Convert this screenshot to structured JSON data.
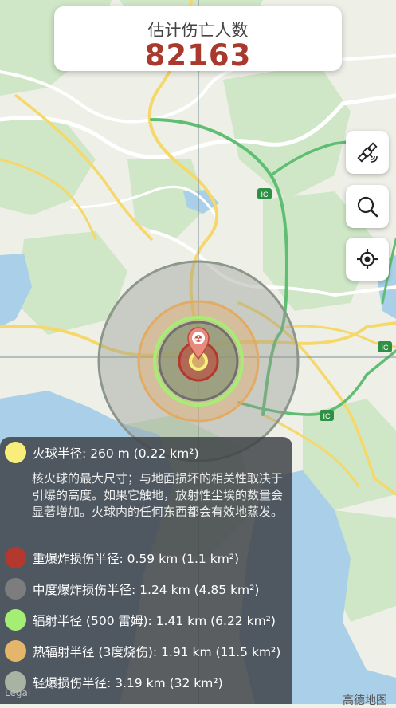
{
  "header": {
    "title": "估计伤亡人数",
    "casualties": "82163"
  },
  "buttons": {
    "satellite_icon": "satellite-icon",
    "search_icon": "search-icon",
    "locate_icon": "locate-icon"
  },
  "map": {
    "road_badges": [
      "IC",
      "IC",
      "IC"
    ],
    "marker_label": "☢",
    "legal": "Legal",
    "brand": "高德地图"
  },
  "legend": {
    "fireball": {
      "label": "火球半径: 260 m (0.22 km²)",
      "color": "#f7ef7a",
      "description": "核火球的最大尺寸；与地面损坏的相关性取决于引爆的高度。如果它触地，放射性尘埃的数量会显著增加。火球内的任何东西都会有效地蒸发。"
    },
    "heavy": {
      "label": "重爆炸损伤半径: 0.59 km (1.1 km²)",
      "color": "#b5382e"
    },
    "moderate": {
      "label": "中度爆炸损伤半径: 1.24 km (4.85 km²)",
      "color": "#7d7d7d"
    },
    "radiation": {
      "label": "辐射半径 (500 雷姆): 1.41 km (6.22 km²)",
      "color": "#a6ee73"
    },
    "thermal": {
      "label": "热辐射半径 (3度烧伤): 1.91 km (11.5 km²)",
      "color": "#e6b56c"
    },
    "light": {
      "label": "轻爆损伤半径: 3.19 km (32 km²)",
      "color": "#a9b3a2"
    }
  }
}
